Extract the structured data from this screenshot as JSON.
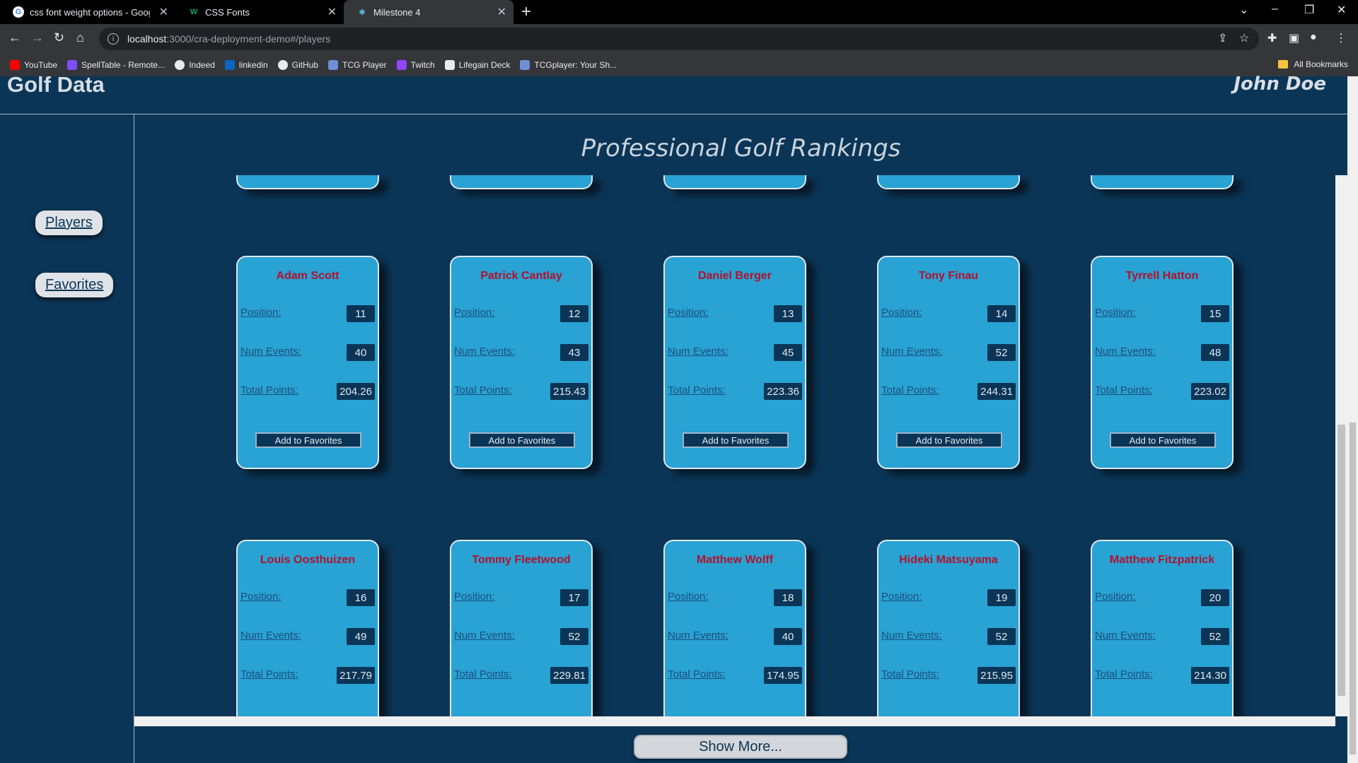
{
  "browser": {
    "tabs": [
      {
        "title": "css font weight options - Google",
        "icon": "google-icon"
      },
      {
        "title": "CSS Fonts",
        "icon": "w3schools-icon"
      },
      {
        "title": "Milestone 4",
        "icon": "react-icon"
      }
    ],
    "url_host": "localhost",
    "url_path": ":3000/cra-deployment-demo#/players",
    "bookmarks": [
      "YouTube",
      "SpellTable - Remote...",
      "Indeed",
      "linkedin",
      "GitHub",
      "TCG Player",
      "Twitch",
      "Lifegain Deck",
      "TCGplayer: Your Sh..."
    ],
    "all_bookmarks": "All Bookmarks"
  },
  "header": {
    "brand": "Golf Data",
    "user": "John Doe"
  },
  "sidebar": {
    "players": "Players",
    "favorites": "Favorites"
  },
  "main": {
    "title": "Professional Golf Rankings",
    "labels": {
      "position": "Position:",
      "events": "Num Events:",
      "points": "Total Points:",
      "add": "Add to Favorites"
    },
    "players": [
      {
        "name": "Adam Scott",
        "position": "11",
        "events": "40",
        "points": "204.26"
      },
      {
        "name": "Patrick Cantlay",
        "position": "12",
        "events": "43",
        "points": "215.43"
      },
      {
        "name": "Daniel Berger",
        "position": "13",
        "events": "45",
        "points": "223.36"
      },
      {
        "name": "Tony Finau",
        "position": "14",
        "events": "52",
        "points": "244.31"
      },
      {
        "name": "Tyrrell Hatton",
        "position": "15",
        "events": "48",
        "points": "223.02"
      },
      {
        "name": "Louis Oosthuizen",
        "position": "16",
        "events": "49",
        "points": "217.79"
      },
      {
        "name": "Tommy Fleetwood",
        "position": "17",
        "events": "52",
        "points": "229.81"
      },
      {
        "name": "Matthew Wolff",
        "position": "18",
        "events": "40",
        "points": "174.95"
      },
      {
        "name": "Hideki Matsuyama",
        "position": "19",
        "events": "52",
        "points": "215.95"
      },
      {
        "name": "Matthew Fitzpatrick",
        "position": "20",
        "events": "52",
        "points": "214.30"
      }
    ],
    "show_more": "Show More..."
  },
  "colors": {
    "background": "#0b3556",
    "card": "#29a2d4",
    "name": "#b3112d"
  }
}
